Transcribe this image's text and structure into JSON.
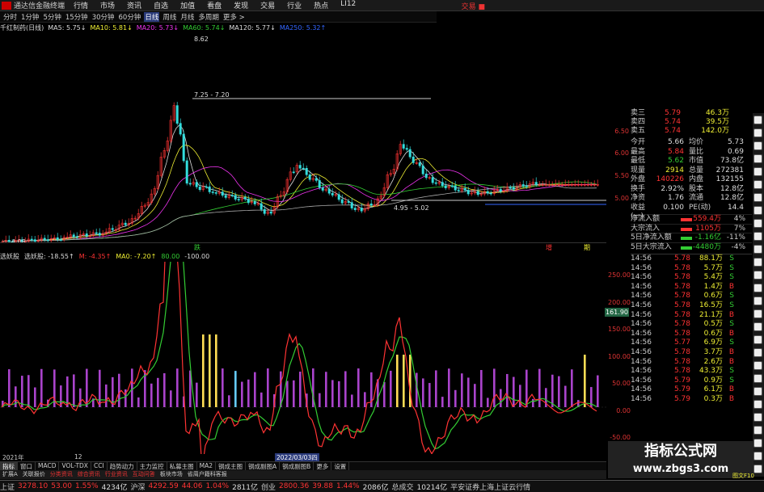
{
  "menubar": {
    "app": "通达信金融终端",
    "items": [
      "行情",
      "市场",
      "资讯",
      "自选",
      "加值",
      "看盘",
      "发现",
      "交易",
      "行业",
      "热点",
      "LI12"
    ],
    "trade": "交易 ■"
  },
  "toolbar": [
    "分时",
    "1分钟",
    "5分钟",
    "15分钟",
    "30分钟",
    "60分钟",
    "日线",
    "周线",
    "月线",
    "多周期",
    "更多 >"
  ],
  "toolbar_active": 6,
  "ma_bar": [
    {
      "t": "千红制药(日线)",
      "c": "#ddd"
    },
    {
      "t": "MA5: 5.75↓",
      "c": "#ddd"
    },
    {
      "t": "MA10: 5.81↓",
      "c": "#ee3"
    },
    {
      "t": "MA20: 5.73↓",
      "c": "#e3e"
    },
    {
      "t": "MA60: 5.74↓",
      "c": "#3c3"
    },
    {
      "t": "MA120: 5.77↓",
      "c": "#ddd"
    },
    {
      "t": "MA250: 5.32↑",
      "c": "#36f"
    }
  ],
  "annotations": {
    "hi": "8.62",
    "range1": "7.25 - 7.20",
    "range2": "4.95 - 5.02",
    "lo": "4.08"
  },
  "axis1_labels": {
    "a": "跌",
    "b": "增",
    "c": "期"
  },
  "ind_bar": [
    {
      "t": "选妖股",
      "c": "#ddd"
    },
    {
      "t": "选妖股: -18.55↑",
      "c": "#ddd"
    },
    {
      "t": "M: -4.35↑",
      "c": "#f33"
    },
    {
      "t": "MA0: -7.20↑",
      "c": "#ee3"
    },
    {
      "t": "80.00",
      "c": "#3c3"
    },
    {
      "t": "-100.00",
      "c": "#ddd"
    }
  ],
  "price_axis": [
    "6.50",
    "6.00",
    "5.50",
    "5.00"
  ],
  "ind_axis": [
    "250.00",
    "200.00",
    "150.00",
    "100.00",
    "50.00",
    "0.00",
    "-50.00"
  ],
  "price_box": "161.90",
  "date_axis": {
    "y": "2021年",
    "m1": "12",
    "d1": "2022/03/03四"
  },
  "orderbook": [
    {
      "l": "卖三",
      "p": "5.79",
      "v": "46.3万"
    },
    {
      "l": "卖四",
      "p": "5.74",
      "v": "39.5万"
    },
    {
      "l": "卖五",
      "p": "5.74",
      "v": "142.0万"
    }
  ],
  "quote": [
    {
      "l": "今开",
      "v": "5.66",
      "vc": "#ddd",
      "l2": "均价",
      "v2": "5.73"
    },
    {
      "l": "最高",
      "v": "5.84",
      "vc": "#f33",
      "l2": "量比",
      "v2": "0.69"
    },
    {
      "l": "最低",
      "v": "5.62",
      "vc": "#3c3",
      "l2": "市值",
      "v2": "73.8亿"
    },
    {
      "l": "现量",
      "v": "2914",
      "vc": "#ee3",
      "l2": "总量",
      "v2": "272381"
    },
    {
      "l": "外盘",
      "v": "140226",
      "vc": "#f33",
      "l2": "内盘",
      "v2": "132155"
    },
    {
      "l": "换手",
      "v": "2.92%",
      "vc": "#ddd",
      "l2": "股本",
      "v2": "12.8亿"
    },
    {
      "l": "净资",
      "v": "1.76",
      "vc": "#ddd",
      "l2": "流通",
      "v2": "12.8亿"
    },
    {
      "l": "收益(一)",
      "v": "0.100",
      "vc": "#ddd",
      "l2": "PE(动)",
      "v2": "14.4"
    }
  ],
  "fundflow": [
    {
      "l": "净流入额",
      "v": "559.4万",
      "vc": "#f33",
      "pc": "4%",
      "bc": "#f33"
    },
    {
      "l": "大宗流入",
      "v": "1105万",
      "vc": "#f33",
      "pc": "7%",
      "bc": "#f33"
    },
    {
      "l": "5日净流入额",
      "v": "-1.16亿",
      "vc": "#3c3",
      "pc": "-11%",
      "bc": "#3c3"
    },
    {
      "l": "5日大宗流入",
      "v": "-4480万",
      "vc": "#3c3",
      "pc": "-4%",
      "bc": "#3c3"
    }
  ],
  "ticks": [
    {
      "t": "14:56",
      "p": "5.78",
      "v": "88.1万",
      "s": "S"
    },
    {
      "t": "14:56",
      "p": "5.78",
      "v": "5.7万",
      "s": "S"
    },
    {
      "t": "14:56",
      "p": "5.78",
      "v": "5.4万",
      "s": "S"
    },
    {
      "t": "14:56",
      "p": "5.78",
      "v": "1.4万",
      "s": "B"
    },
    {
      "t": "14:56",
      "p": "5.78",
      "v": "0.6万",
      "s": "S"
    },
    {
      "t": "14:56",
      "p": "5.78",
      "v": "16.5万",
      "s": "S"
    },
    {
      "t": "14:56",
      "p": "5.78",
      "v": "21.1万",
      "s": "B"
    },
    {
      "t": "14:56",
      "p": "5.78",
      "v": "0.5万",
      "s": "S"
    },
    {
      "t": "14:56",
      "p": "5.78",
      "v": "0.6万",
      "s": "B"
    },
    {
      "t": "14:56",
      "p": "5.77",
      "v": "6.9万",
      "s": "S"
    },
    {
      "t": "14:56",
      "p": "5.78",
      "v": "3.7万",
      "s": "B"
    },
    {
      "t": "14:56",
      "p": "5.78",
      "v": "2.6万",
      "s": "B"
    },
    {
      "t": "14:56",
      "p": "5.78",
      "v": "43.3万",
      "s": "S"
    },
    {
      "t": "14:56",
      "p": "5.79",
      "v": "0.9万",
      "s": "S"
    },
    {
      "t": "14:56",
      "p": "5.79",
      "v": "6.1万",
      "s": "B"
    },
    {
      "t": "14:56",
      "p": "5.79",
      "v": "0.3万",
      "s": "B"
    }
  ],
  "tabs": [
    "指标",
    "窗口",
    "MACD",
    "VOL-TDX",
    "CCI",
    "趋势动力",
    "主力监控",
    "私募主图",
    "MA2",
    "钢成主图",
    "钢成副图A",
    "钢成副图B",
    "更多",
    "设置"
  ],
  "tabs_active": 0,
  "subtabs": [
    "扩展A",
    "关联报价",
    "分类资讯",
    "综合资讯",
    "行业资讯",
    "互动问答",
    "板块市场",
    "省周户籍科客报"
  ],
  "status": [
    {
      "t": "上证",
      "c": "#ccc"
    },
    {
      "t": "3278.10",
      "c": "#f33"
    },
    {
      "t": "53.00",
      "c": "#f33"
    },
    {
      "t": "1.55%",
      "c": "#f33"
    },
    {
      "t": "4234亿",
      "c": "#ddd"
    },
    {
      "t": "沪深",
      "c": "#ccc"
    },
    {
      "t": "4292.59",
      "c": "#f33"
    },
    {
      "t": "44.06",
      "c": "#f33"
    },
    {
      "t": "1.04%",
      "c": "#f33"
    },
    {
      "t": "2811亿",
      "c": "#ddd"
    },
    {
      "t": "创业",
      "c": "#ccc"
    },
    {
      "t": "2800.36",
      "c": "#f33"
    },
    {
      "t": "39.88",
      "c": "#f33"
    },
    {
      "t": "1.44%",
      "c": "#f33"
    },
    {
      "t": "2086亿",
      "c": "#ddd"
    },
    {
      "t": "总成交",
      "c": "#ccc"
    },
    {
      "t": "10214亿",
      "c": "#ddd"
    },
    {
      "t": "平安证券上海上证云行情",
      "c": "#ccc"
    }
  ],
  "watermark": {
    "l1": "指标公式网",
    "l2": "www.zbgs3.com"
  },
  "corner": "图文F10"
}
